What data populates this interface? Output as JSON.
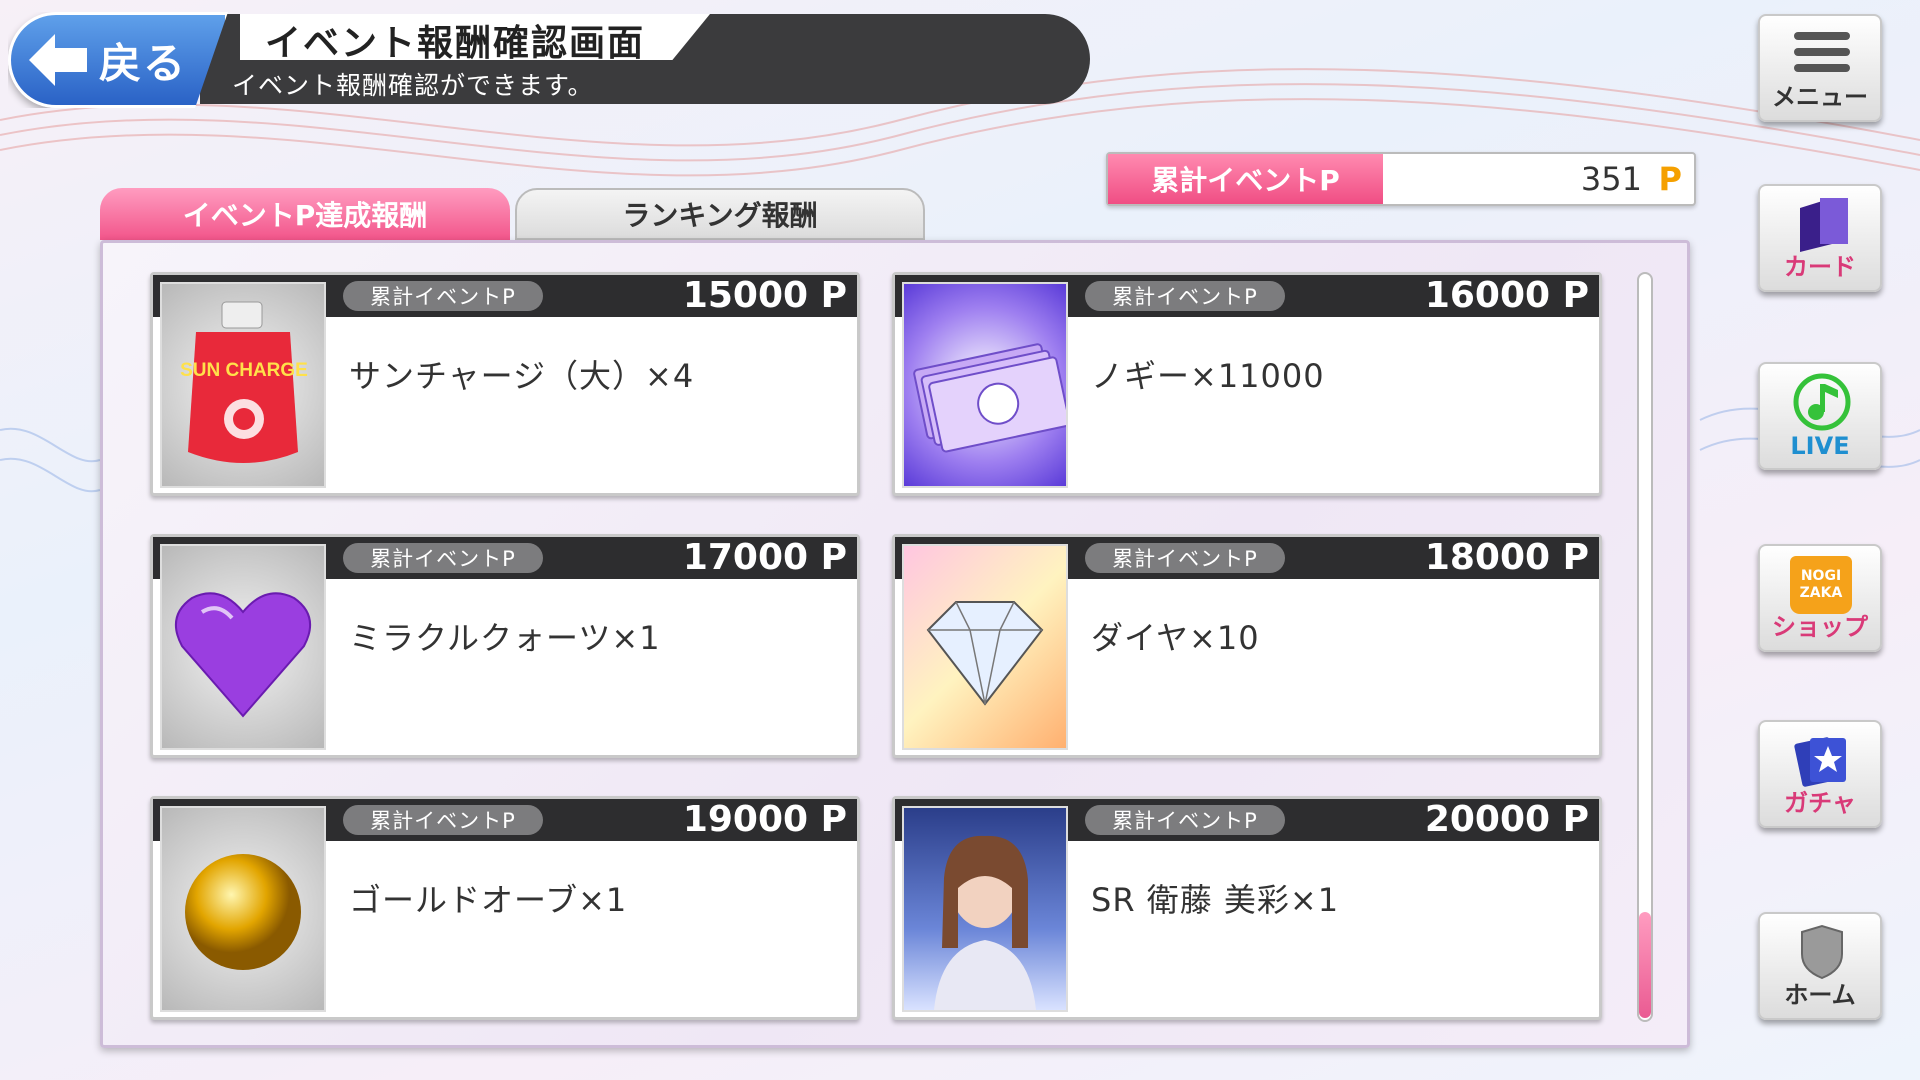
{
  "header": {
    "back_label": "戻る",
    "title": "イベント報酬確認画面",
    "subtitle": "イベント報酬確認ができます。"
  },
  "total": {
    "label": "累計イベントP",
    "value": "351",
    "unit": "P"
  },
  "tabs": [
    {
      "label": "イベントP達成報酬",
      "active": true
    },
    {
      "label": "ランキング報酬",
      "active": false
    }
  ],
  "rewards": [
    {
      "badge": "累計イベントP",
      "points": "15000 P",
      "name": "サンチャージ（大）×4",
      "icon": "sun-charge-pouch-icon",
      "thumb_text": "SUN CHARGE"
    },
    {
      "badge": "累計イベントP",
      "points": "16000 P",
      "name": "ノギー×11000",
      "icon": "nogi-money-icon"
    },
    {
      "badge": "累計イベントP",
      "points": "17000 P",
      "name": "ミラクルクォーツ×1",
      "icon": "purple-heart-crystal-icon"
    },
    {
      "badge": "累計イベントP",
      "points": "18000 P",
      "name": "ダイヤ×10",
      "icon": "diamond-icon"
    },
    {
      "badge": "累計イベントP",
      "points": "19000 P",
      "name": "ゴールドオーブ×1",
      "icon": "gold-orb-icon"
    },
    {
      "badge": "累計イベントP",
      "points": "20000 P",
      "name": "SR 衛藤 美彩×1",
      "icon": "member-card-icon"
    }
  ],
  "side_menu": {
    "menu": "メニュー",
    "card": "カード",
    "live": "LIVE",
    "shop_logo": "NOGI ZAKA",
    "shop": "ショップ",
    "gacha": "ガチャ",
    "home": "ホーム"
  },
  "colors": {
    "accent_pink": "#f04e84",
    "header_dark": "#3b3b3d",
    "back_blue": "#2a62c6",
    "points_orange": "#f5a000"
  }
}
